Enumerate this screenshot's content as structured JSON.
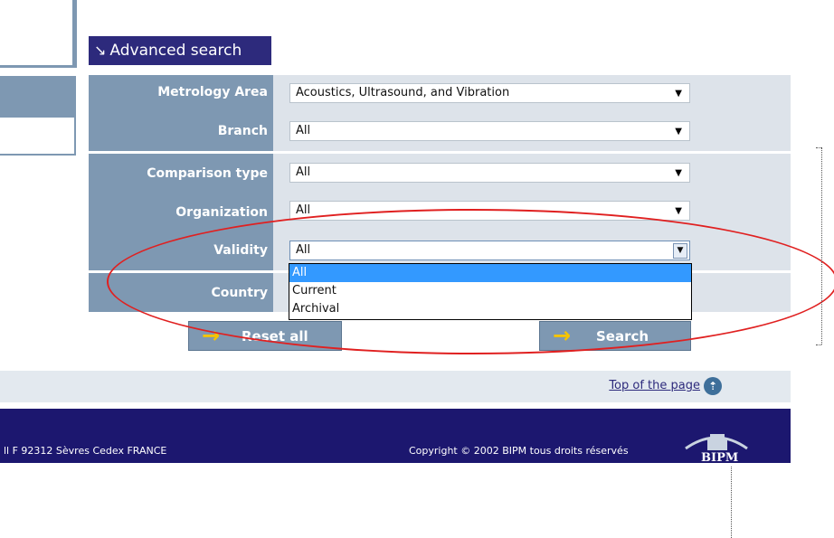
{
  "header": {
    "title": "Advanced search",
    "arrow": "↘"
  },
  "fields": [
    {
      "label": "Metrology Area",
      "value": "Acoustics, Ultrasound, and Vibration"
    },
    {
      "label": "Branch",
      "value": "All"
    },
    {
      "label": "Comparison type",
      "value": "All"
    },
    {
      "label": "Organization",
      "value": "All"
    },
    {
      "label": "Validity",
      "value": "All"
    },
    {
      "label": "Country",
      "value": ""
    }
  ],
  "validity_options": [
    "All",
    "Current",
    "Archival"
  ],
  "buttons": {
    "reset": "Reset all",
    "search": "Search"
  },
  "top_link": "Top of the page",
  "footer": {
    "address": "ll F  92312 Sèvres Cedex FRANCE",
    "copyright": "Copyright © 2002 BIPM  tous droits réservés",
    "logo_text": "BIPM"
  },
  "colors": {
    "header_bg": "#2d2a7c",
    "label_bg": "#7e98b2",
    "panel_bg": "#dde3ea",
    "highlight": "#3399ff",
    "annotation": "#e02020"
  }
}
